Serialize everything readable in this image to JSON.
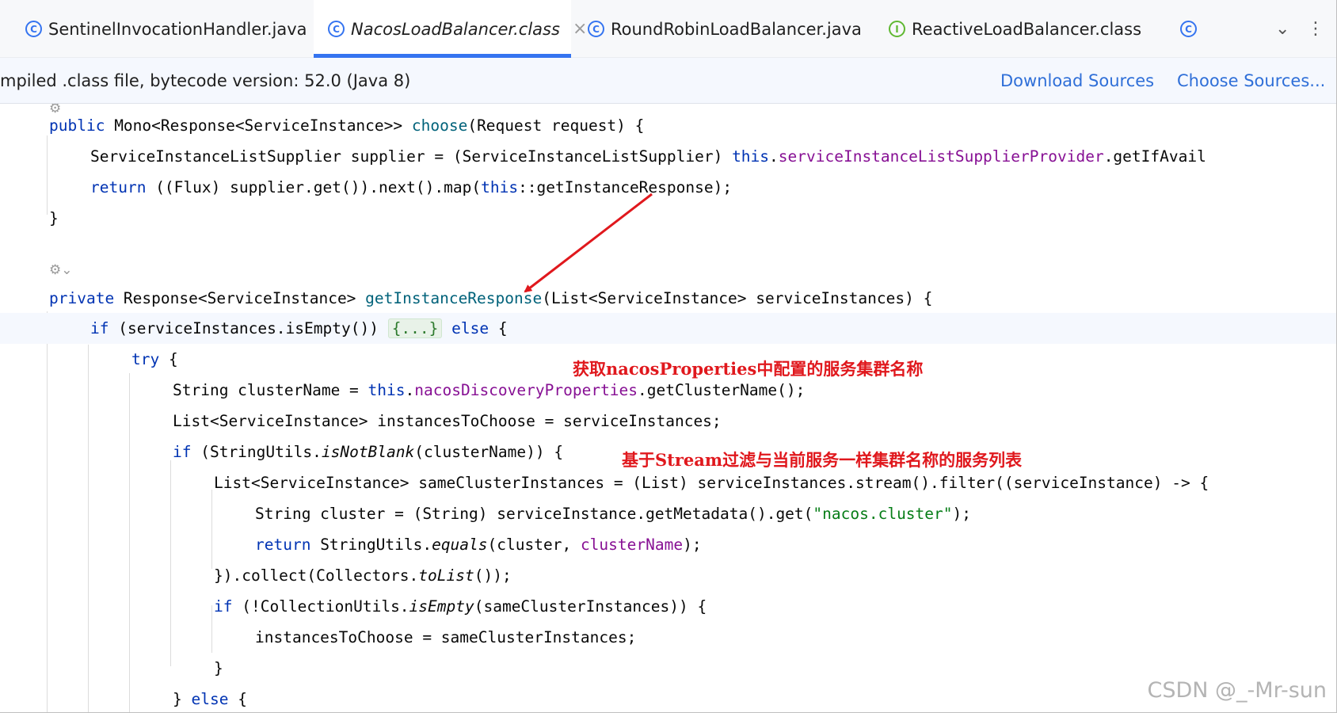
{
  "tabs": [
    {
      "label": "SentinelInvocationHandler.java",
      "icon": "class-icon"
    },
    {
      "label": "NacosLoadBalancer.class",
      "icon": "class-icon",
      "active": true
    },
    {
      "label": "RoundRobinLoadBalancer.java",
      "icon": "class-icon"
    },
    {
      "label": "ReactiveLoadBalancer.class",
      "icon": "interface-icon"
    }
  ],
  "notice": {
    "message": "mpiled .class file, bytecode version: 52.0 (Java 8)",
    "download_sources": "Download Sources",
    "choose_sources": "Choose Sources..."
  },
  "code": {
    "l1": {
      "kw": "public",
      "a": " Mono<Response<ServiceInstance>> ",
      "fn": "choose",
      "b": "(Request request) {"
    },
    "l2": {
      "a": "ServiceInstanceListSupplier supplier = (ServiceInstanceListSupplier) ",
      "kw": "this",
      "dot": ".",
      "fld": "serviceInstanceListSupplierProvider",
      "b": ".getIfAvail"
    },
    "l3": {
      "kw": "return",
      "a": " ((Flux) supplier.get()).next().map(",
      "kw2": "this",
      "b": "::getInstanceResponse);"
    },
    "l4": {
      "a": "}"
    },
    "l5": {
      "kw": "private",
      "a": " Response<ServiceInstance> ",
      "fn": "getInstanceResponse",
      "b": "(List<ServiceInstance> serviceInstances) {"
    },
    "l6": {
      "kw": "if",
      "a": " (serviceInstances.isEmpty()) ",
      "fold": "{...}",
      "sp": " ",
      "kw2": "else",
      "b": " {"
    },
    "l7": {
      "kw": "try",
      "a": " {"
    },
    "l8": {
      "a": "String clusterName = ",
      "kw": "this",
      "dot": ".",
      "fld": "nacosDiscoveryProperties",
      "b": ".getClusterName();"
    },
    "l9": {
      "a": "List<ServiceInstance> instancesToChoose = serviceInstances;"
    },
    "l10": {
      "kw": "if",
      "a": " (StringUtils.",
      "it": "isNotBlank",
      "b": "(clusterName)) {"
    },
    "l11": {
      "a": "List<ServiceInstance> sameClusterInstances = (List) serviceInstances.stream().filter((serviceInstance) -> {"
    },
    "l12": {
      "a": "String cluster = (String) serviceInstance.getMetadata().get(",
      "str": "\"nacos.cluster\"",
      "b": ");"
    },
    "l13": {
      "kw": "return",
      "a": " StringUtils.",
      "it": "equals",
      "b": "(cluster, ",
      "fld": "clusterName",
      "c": ");"
    },
    "l14": {
      "a": "}).collect(Collectors.",
      "it": "toList",
      "b": "());"
    },
    "l15": {
      "kw": "if",
      "a": " (!CollectionUtils.",
      "it": "isEmpty",
      "b": "(sameClusterInstances)) {"
    },
    "l16": {
      "a": "instancesToChoose = sameClusterInstances;"
    },
    "l17": {
      "a": "}"
    },
    "l18": {
      "a": "} ",
      "kw": "else",
      "b": " {"
    }
  },
  "annotations": {
    "note1": "获取nacosProperties中配置的服务集群名称",
    "note2": "基于Stream过滤与当前服务一样集群名称的服务列表"
  },
  "watermark": "CSDN @_-Mr-sun",
  "colors": {
    "keyword": "#0033b3",
    "method": "#00627a",
    "field": "#871094",
    "string": "#067d17",
    "annotation": "#e0181d",
    "link": "#2f6fd8",
    "tab_accent": "#3574f0"
  }
}
